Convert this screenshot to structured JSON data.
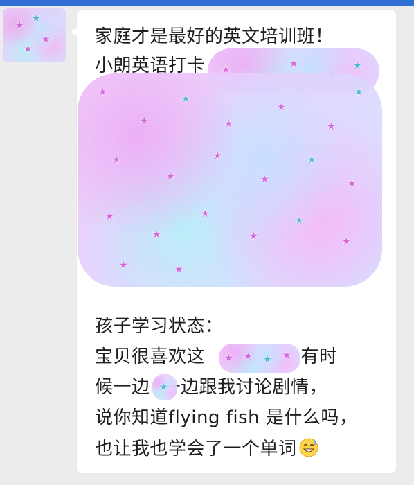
{
  "message": {
    "lines": [
      "家庭才是最好的英文培训班！",
      "小朗英语打卡",
      "孩子学习状态：",
      "宝贝很喜欢这",
      "，有时",
      "候一边",
      "一边跟我讨论剧情，",
      "说你知道flying fish 是什么吗，",
      "也让我也学会了一个单词"
    ]
  },
  "colors": {
    "top_bar": "#2f6fd6",
    "background": "#ececec",
    "bubble": "#ffffff",
    "text": "#1f1f1f",
    "sticker_pink": "#e8b7f0",
    "sticker_cyan": "#bdeff7"
  },
  "icons": {
    "emoji": "grinning-face-with-sweat-icon",
    "sticker_star": "star-icon"
  }
}
